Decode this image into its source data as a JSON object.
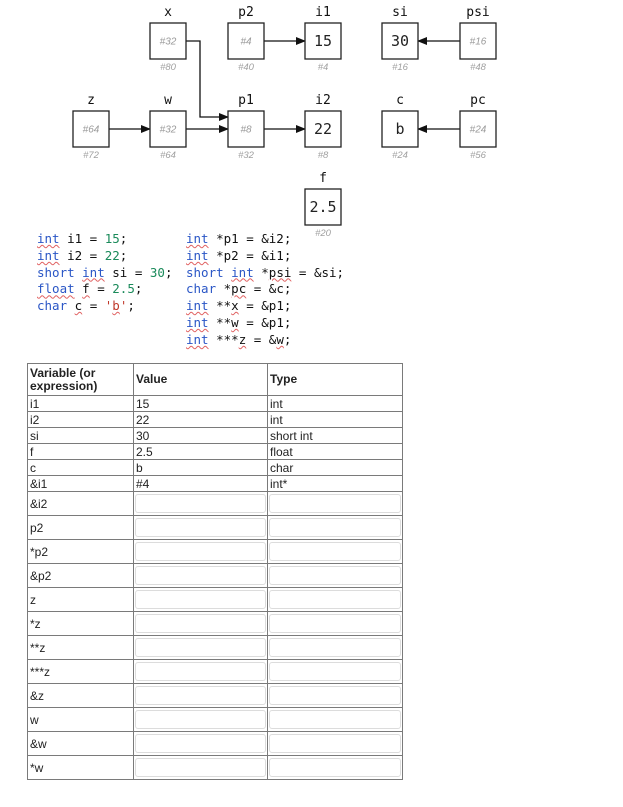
{
  "diagram": {
    "boxes": [
      {
        "id": "x",
        "name": "x",
        "content": "#32",
        "content_kind": "address",
        "address": "#80"
      },
      {
        "id": "p2",
        "name": "p2",
        "content": "#4",
        "content_kind": "address",
        "address": "#40"
      },
      {
        "id": "i1",
        "name": "i1",
        "content": "15",
        "content_kind": "value",
        "address": "#4"
      },
      {
        "id": "si",
        "name": "si",
        "content": "30",
        "content_kind": "value",
        "address": "#16"
      },
      {
        "id": "psi",
        "name": "psi",
        "content": "#16",
        "content_kind": "address",
        "address": "#48"
      },
      {
        "id": "z",
        "name": "z",
        "content": "#64",
        "content_kind": "address",
        "address": "#72"
      },
      {
        "id": "w",
        "name": "w",
        "content": "#32",
        "content_kind": "address",
        "address": "#64"
      },
      {
        "id": "p1",
        "name": "p1",
        "content": "#8",
        "content_kind": "address",
        "address": "#32"
      },
      {
        "id": "i2",
        "name": "i2",
        "content": "22",
        "content_kind": "value",
        "address": "#8"
      },
      {
        "id": "c",
        "name": "c",
        "content": "b",
        "content_kind": "value",
        "address": "#24"
      },
      {
        "id": "pc",
        "name": "pc",
        "content": "#24",
        "content_kind": "address",
        "address": "#56"
      },
      {
        "id": "f",
        "name": "f",
        "content": "2.5",
        "content_kind": "value",
        "address": "#20"
      }
    ],
    "arrows": [
      {
        "from": "p2",
        "to": "i1"
      },
      {
        "from": "psi",
        "to": "si"
      },
      {
        "from": "x",
        "to": "p1"
      },
      {
        "from": "z",
        "to": "w"
      },
      {
        "from": "w",
        "to": "p1"
      },
      {
        "from": "p1",
        "to": "i2"
      },
      {
        "from": "pc",
        "to": "c"
      }
    ]
  },
  "code": {
    "left": [
      [
        {
          "t": "int",
          "c": "kw sq"
        },
        {
          "t": " i1 = "
        },
        {
          "t": "15",
          "c": "num"
        },
        {
          "t": ";"
        }
      ],
      [
        {
          "t": "int",
          "c": "kw sq"
        },
        {
          "t": " i2 = "
        },
        {
          "t": "22",
          "c": "num"
        },
        {
          "t": ";"
        }
      ],
      [
        {
          "t": "short ",
          "c": "kw"
        },
        {
          "t": "int",
          "c": "kw sq"
        },
        {
          "t": " si = "
        },
        {
          "t": "30",
          "c": "num"
        },
        {
          "t": ";"
        }
      ],
      [
        {
          "t": "float",
          "c": "kw sq"
        },
        {
          "t": " "
        },
        {
          "t": "f",
          "c": "sq"
        },
        {
          "t": " = "
        },
        {
          "t": "2.5",
          "c": "num"
        },
        {
          "t": ";"
        }
      ],
      [
        {
          "t": "char",
          "c": "kw"
        },
        {
          "t": " "
        },
        {
          "t": "c",
          "c": "sq"
        },
        {
          "t": " = "
        },
        {
          "t": "'",
          "c": "chr"
        },
        {
          "t": "b",
          "c": "chr sq"
        },
        {
          "t": "'",
          "c": "chr"
        },
        {
          "t": ";"
        }
      ]
    ],
    "right": [
      [
        {
          "t": "int",
          "c": "kw sq"
        },
        {
          "t": " *p1 = &i2;"
        }
      ],
      [
        {
          "t": "int",
          "c": "kw sq"
        },
        {
          "t": " *p2 = &i1;"
        }
      ],
      [
        {
          "t": "short ",
          "c": "kw"
        },
        {
          "t": "int",
          "c": "kw sq"
        },
        {
          "t": " *"
        },
        {
          "t": "psi",
          "c": "sq"
        },
        {
          "t": " = &si;"
        }
      ],
      [
        {
          "t": "char",
          "c": "kw"
        },
        {
          "t": " *"
        },
        {
          "t": "pc",
          "c": "sq"
        },
        {
          "t": " = &c;"
        }
      ],
      [
        {
          "t": "int",
          "c": "kw sq"
        },
        {
          "t": " **"
        },
        {
          "t": "x",
          "c": "sq"
        },
        {
          "t": " = &p1;"
        }
      ],
      [
        {
          "t": "int",
          "c": "kw sq"
        },
        {
          "t": " **"
        },
        {
          "t": "w",
          "c": "sq"
        },
        {
          "t": " = &p1;"
        }
      ],
      [
        {
          "t": "int",
          "c": "kw sq"
        },
        {
          "t": " ***"
        },
        {
          "t": "z",
          "c": "sq"
        },
        {
          "t": " = &"
        },
        {
          "t": "w",
          "c": "sq"
        },
        {
          "t": ";"
        }
      ]
    ]
  },
  "table": {
    "headers": {
      "variable": "Variable (or expression)",
      "value": "Value",
      "type": "Type"
    },
    "filled_rows": [
      {
        "variable": "i1",
        "value": "15",
        "type": "int"
      },
      {
        "variable": "i2",
        "value": "22",
        "type": "int"
      },
      {
        "variable": "si",
        "value": "30",
        "type": "short int"
      },
      {
        "variable": "f",
        "value": "2.5",
        "type": "float"
      },
      {
        "variable": "c",
        "value": "b",
        "type": "char"
      },
      {
        "variable": "&i1",
        "value": "#4",
        "type": "int*"
      }
    ],
    "input_rows": [
      {
        "variable": "&i2",
        "value": "",
        "type": ""
      },
      {
        "variable": "p2",
        "value": "",
        "type": ""
      },
      {
        "variable": "*p2",
        "value": "",
        "type": ""
      },
      {
        "variable": "&p2",
        "value": "",
        "type": ""
      },
      {
        "variable": "z",
        "value": "",
        "type": ""
      },
      {
        "variable": "*z",
        "value": "",
        "type": ""
      },
      {
        "variable": "**z",
        "value": "",
        "type": ""
      },
      {
        "variable": "***z",
        "value": "",
        "type": ""
      },
      {
        "variable": "&z",
        "value": "",
        "type": ""
      },
      {
        "variable": "w",
        "value": "",
        "type": ""
      },
      {
        "variable": "&w",
        "value": "",
        "type": ""
      },
      {
        "variable": "*w",
        "value": "",
        "type": ""
      }
    ]
  }
}
